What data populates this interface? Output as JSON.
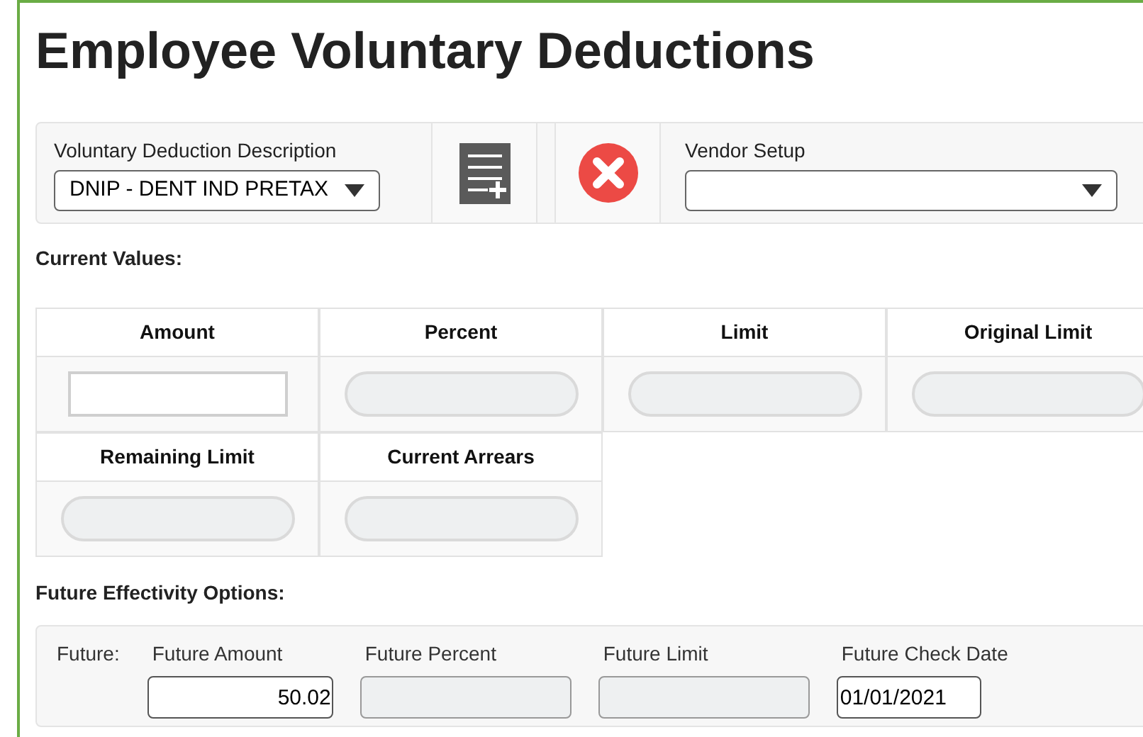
{
  "title": "Employee Voluntary Deductions",
  "deduction": {
    "label": "Voluntary Deduction Description",
    "value": "DNIP - DENT IND PRETAX"
  },
  "vendor": {
    "label": "Vendor Setup"
  },
  "current_values": {
    "heading": "Current Values:",
    "fields": [
      {
        "label": "Amount",
        "disabled": false
      },
      {
        "label": "Percent",
        "disabled": true
      },
      {
        "label": "Limit",
        "disabled": true
      },
      {
        "label": "Original Limit",
        "disabled": true
      },
      {
        "label": "Remaining Limit",
        "disabled": true
      },
      {
        "label": "Current Arrears",
        "disabled": true
      }
    ]
  },
  "future": {
    "heading": "Future Effectivity Options:",
    "prefix": "Future:",
    "fields": [
      {
        "label": "Future Amount",
        "value": "50.02",
        "disabled": false
      },
      {
        "label": "Future Percent",
        "disabled": true
      },
      {
        "label": "Future Limit",
        "disabled": true
      },
      {
        "label": "Future Check Date",
        "value": "01/01/2021",
        "disabled": false
      }
    ]
  }
}
